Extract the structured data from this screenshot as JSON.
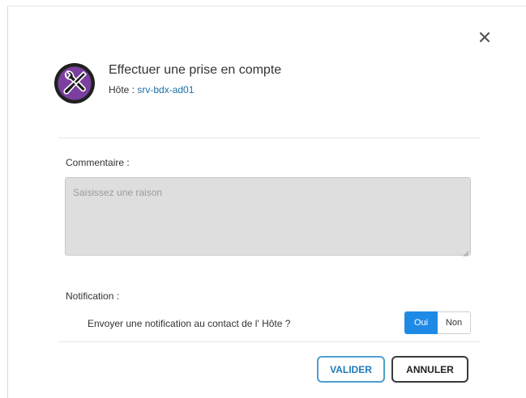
{
  "dialog": {
    "title": "Effectuer une prise en compte",
    "host_label": "Hôte :",
    "host_name": "srv-bdx-ad01",
    "close_icon": "close-icon",
    "header_icon": "tools-icon"
  },
  "comment": {
    "label": "Commentaire :",
    "placeholder": "Saisissez une raison",
    "value": ""
  },
  "notification": {
    "label": "Notification :",
    "question": "Envoyer une notification au contact de l' Hôte ?",
    "options": [
      "Oui",
      "Non"
    ],
    "selected": "Oui"
  },
  "actions": {
    "validate_label": "VALIDER",
    "cancel_label": "ANNULER"
  },
  "colors": {
    "accent": "#1e8ae5",
    "link": "#1a6fa8",
    "icon_purple": "#7b3fa0"
  }
}
